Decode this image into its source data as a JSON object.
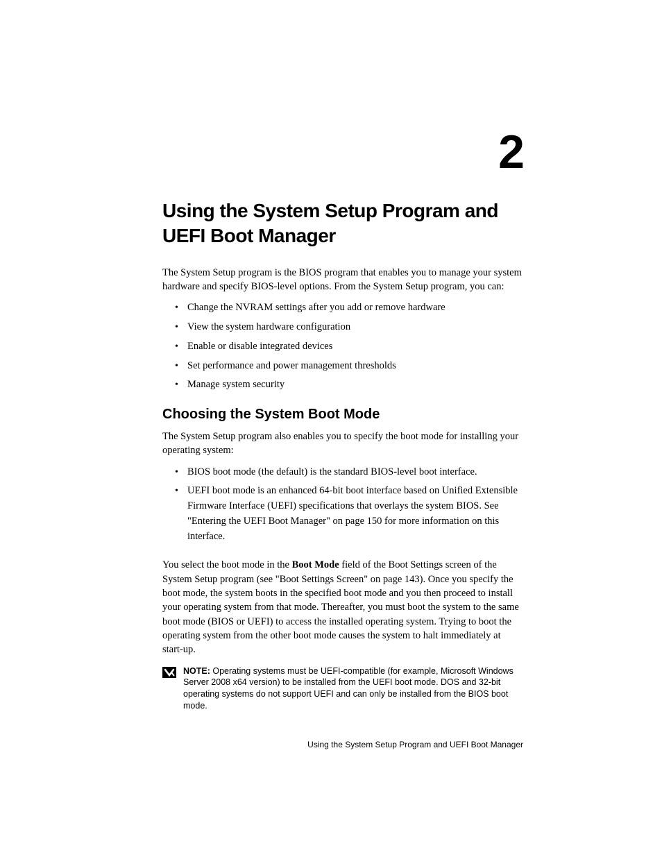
{
  "chapter": {
    "number": "2",
    "title": "Using the System Setup Program and UEFI Boot Manager"
  },
  "intro": {
    "paragraph": "The System Setup program is the BIOS program that enables you to manage your system hardware and specify BIOS-level options. From the System Setup program, you can:",
    "bullets": [
      "Change the NVRAM settings after you add or remove hardware",
      "View the system hardware configuration",
      "Enable or disable integrated devices",
      "Set performance and power management thresholds",
      "Manage system security"
    ]
  },
  "section1": {
    "heading": "Choosing the System Boot Mode",
    "paragraph1": "The System Setup program also enables you to specify the boot mode for installing your operating system:",
    "bullets": [
      "BIOS boot mode (the default) is the standard BIOS-level boot interface.",
      "UEFI boot mode is an enhanced 64-bit boot interface based on Unified Extensible Firmware Interface (UEFI) specifications that overlays the system BIOS. See \"Entering the UEFI Boot Manager\" on page 150 for more information on this interface."
    ],
    "paragraph2_prefix": "You select the boot mode in the ",
    "paragraph2_bold": "Boot Mode",
    "paragraph2_suffix": " field of the Boot Settings screen of the System Setup program (see \"Boot Settings Screen\" on page 143). Once you specify the boot mode, the system boots in the specified boot mode and you then proceed to install your operating system from that mode. Thereafter, you must boot the system to the same boot mode (BIOS or UEFI) to access the installed operating system. Trying to boot the operating system from the other boot mode causes the system to halt immediately at start-up."
  },
  "note": {
    "label": "NOTE:",
    "text": " Operating systems must be UEFI-compatible (for example, Microsoft Windows Server 2008 x64 version) to be installed from the UEFI boot mode. DOS and 32-bit operating systems do not support UEFI and can only be installed from the BIOS boot mode."
  },
  "footer": {
    "text": "Using the System Setup Program and UEFI Boot Manager"
  }
}
